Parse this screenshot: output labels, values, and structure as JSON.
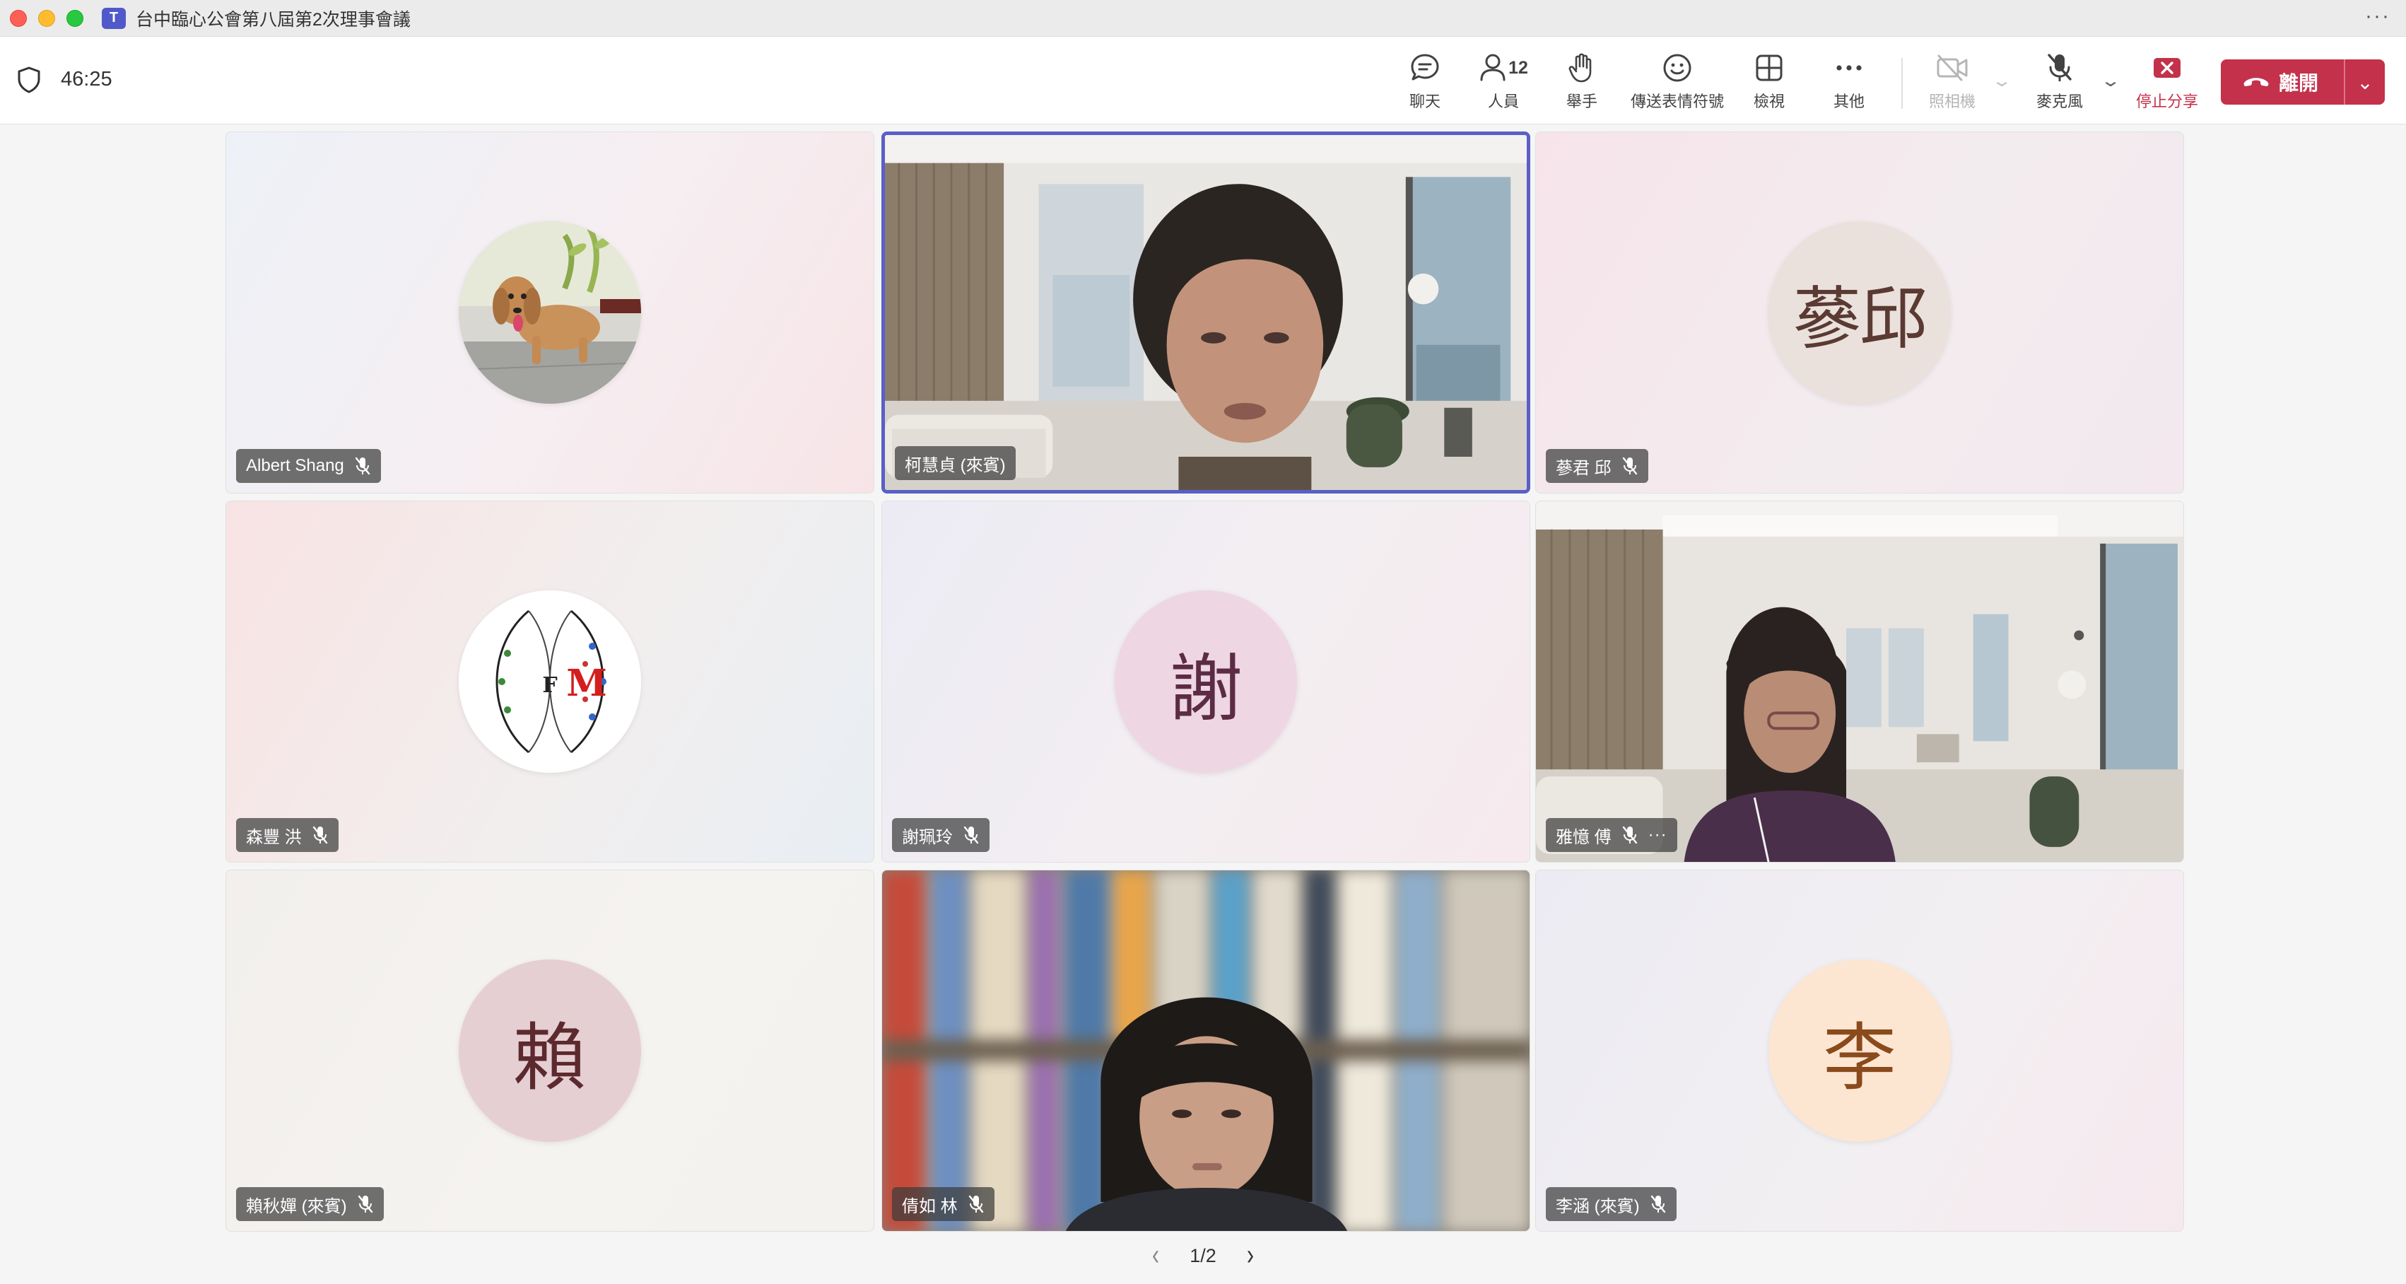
{
  "window": {
    "title": "台中臨心公會第八屆第2次理事會議",
    "app_icon_glyph": "T",
    "more_glyph": "···"
  },
  "toolbar": {
    "timer": "46:25",
    "chat_label": "聊天",
    "people_label": "人員",
    "people_count": "12",
    "raise_hand_label": "舉手",
    "reactions_label": "傳送表情符號",
    "view_label": "檢視",
    "more_label": "其他",
    "camera_label": "照相機",
    "mic_label": "麥克風",
    "stop_share_label": "停止分享",
    "leave_label": "離開",
    "accent_color": "#5b5fc7",
    "leave_color": "#c4314b"
  },
  "tiles": [
    {
      "name": "Albert Shang",
      "avatar_type": "dog-photo",
      "muted": true
    },
    {
      "name": "柯慧貞 (來賓)",
      "avatar_type": "video",
      "active": true,
      "muted": false
    },
    {
      "name": "蔘君 邱",
      "avatar_type": "initials",
      "initials": "蔘邱",
      "muted": true
    },
    {
      "name": "森豐 洪",
      "avatar_type": "logo",
      "logo_text": "M",
      "logo_text_2": "F",
      "muted": true
    },
    {
      "name": "謝珮玲",
      "avatar_type": "initials",
      "initials": "謝",
      "muted": true
    },
    {
      "name": "雅憶 傅",
      "avatar_type": "video",
      "muted": true,
      "has_more": true
    },
    {
      "name": "賴秋嬋 (來賓)",
      "avatar_type": "initials",
      "initials": "賴",
      "muted": true
    },
    {
      "name": "倩如 林",
      "avatar_type": "video",
      "muted": true
    },
    {
      "name": "李涵 (來賓)",
      "avatar_type": "initials",
      "initials": "李",
      "muted": true
    }
  ],
  "tile_more_glyph": "···",
  "pager": {
    "label": "1/2",
    "prev": "‹",
    "next": "›"
  }
}
